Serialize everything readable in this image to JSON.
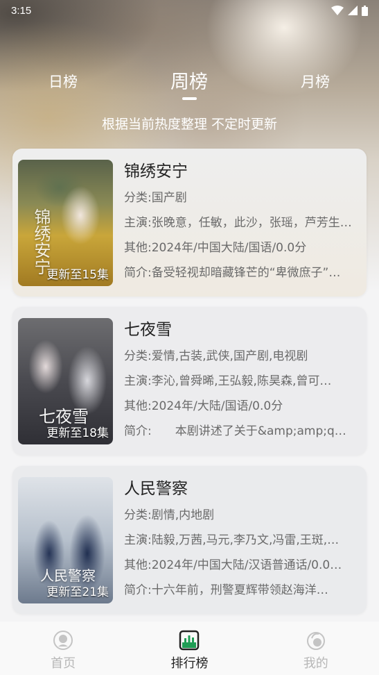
{
  "status_bar": {
    "time": "3:15"
  },
  "tabs": [
    {
      "label": "日榜"
    },
    {
      "label": "周榜"
    },
    {
      "label": "月榜"
    }
  ],
  "subtitle": "根据当前热度整理 不定时更新",
  "cards": [
    {
      "title": "锦绣安宁",
      "category_label": "分类:",
      "category": "国产剧",
      "cast_label": "主演:",
      "cast": "张晚意，任敏，此沙，张瑶，芦芳生…",
      "other_label": "其他:",
      "other": "2024年/中国大陆/国语/0.0分",
      "intro_label": "简介:",
      "intro": "备受轻视却暗藏锋芒的“卑微庶子”…",
      "badge": "更新至15集",
      "poster_title": "锦绣安宁"
    },
    {
      "title": "七夜雪",
      "category_label": "分类:",
      "category": "爱情,古装,武侠,国产剧,电视剧",
      "cast_label": "主演:",
      "cast": "李沁,曾舜晞,王弘毅,陈昊森,曾可…",
      "other_label": "其他:",
      "other": "2024年/大陆/国语/0.0分",
      "intro_label": "简介:",
      "intro": "　　本剧讲述了关于&amp;amp;q…",
      "badge": "更新至18集",
      "poster_title": "七夜雪"
    },
    {
      "title": "人民警察",
      "category_label": "分类:",
      "category": "剧情,内地剧",
      "cast_label": "主演:",
      "cast": "陆毅,万茜,马元,李乃文,冯雷,王斑,…",
      "other_label": "其他:",
      "other": "2024年/中国大陆/汉语普通话/0.0…",
      "intro_label": "简介:",
      "intro": "十六年前，刑警夏辉带领赵海洋…",
      "badge": "更新至21集",
      "poster_title": "人民警察"
    }
  ],
  "bottom_nav": [
    {
      "label": "首页",
      "icon": "home-icon",
      "active": false
    },
    {
      "label": "排行榜",
      "icon": "ranking-icon",
      "active": true
    },
    {
      "label": "我的",
      "icon": "profile-icon",
      "active": false
    }
  ],
  "colors": {
    "active_nav_icon": "#1f9d55",
    "inactive_nav": "#b7b7b7",
    "text_primary": "#222222",
    "text_secondary": "#6a6a6a"
  }
}
